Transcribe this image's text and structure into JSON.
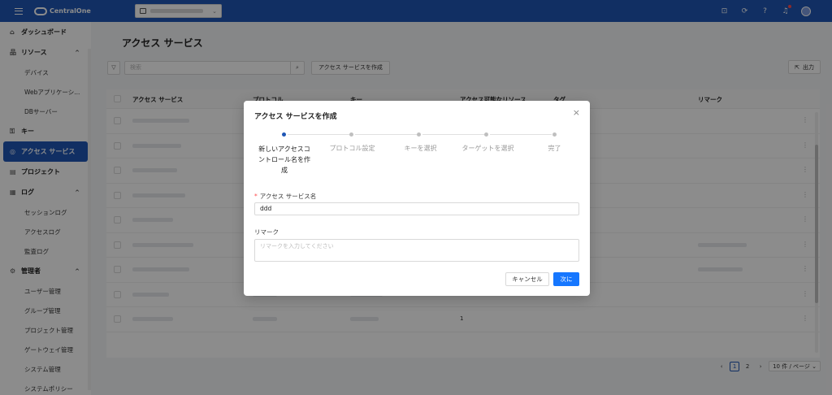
{
  "brand": {
    "name": "CentralOne"
  },
  "sidebar": {
    "items": [
      {
        "icon": "⌂",
        "label": "ダッシュボード"
      },
      {
        "icon": "品",
        "label": "リソース",
        "expanded": true,
        "children": [
          "デバイス",
          "Webアプリケーシ...",
          "DBサーバー"
        ]
      },
      {
        "icon": "⚿",
        "label": "キー"
      },
      {
        "icon": "◎",
        "label": "アクセス サービス",
        "active": true
      },
      {
        "icon": "▤",
        "label": "プロジェクト"
      },
      {
        "icon": "▦",
        "label": "ログ",
        "expanded": true,
        "children": [
          "セッションログ",
          "アクセスログ",
          "監査ログ"
        ]
      },
      {
        "icon": "⚙",
        "label": "管理者",
        "expanded": true,
        "children": [
          "ユーザー管理",
          "グループ管理",
          "プロジェクト管理",
          "ゲートウェイ管理",
          "システム管理",
          "システムポリシー"
        ]
      }
    ],
    "caret": "^"
  },
  "main": {
    "title": "アクセス サービス",
    "search_placeholder": "検索",
    "create_button": "アクセス サービスを作成",
    "export_button": "出力",
    "columns": [
      "アクセス サービス",
      "プロトコル",
      "キー",
      "アクセス可能なリソース",
      "タグ",
      "リマーク"
    ],
    "visible_values": [
      "1",
      "1"
    ],
    "pagination": {
      "pages": [
        "1",
        "2"
      ],
      "current": "1",
      "page_size": "10 件 / ページ"
    }
  },
  "modal": {
    "title": "アクセス サービスを作成",
    "close": "×",
    "steps": [
      {
        "line1": "新しいアクセスコ",
        "line2": "ントロール名を作",
        "line3": "成"
      },
      {
        "line1": "プロトコル設定"
      },
      {
        "line1": "キーを選択"
      },
      {
        "line1": "ターゲットを選択"
      },
      {
        "line1": "完了"
      }
    ],
    "name_label": "アクセス サービス名",
    "name_required": "*",
    "name_value": "ddd",
    "remark_label": "リマーク",
    "remark_placeholder": "リマークを入力してください",
    "cancel_button": "キャンセル",
    "next_button": "次に"
  }
}
